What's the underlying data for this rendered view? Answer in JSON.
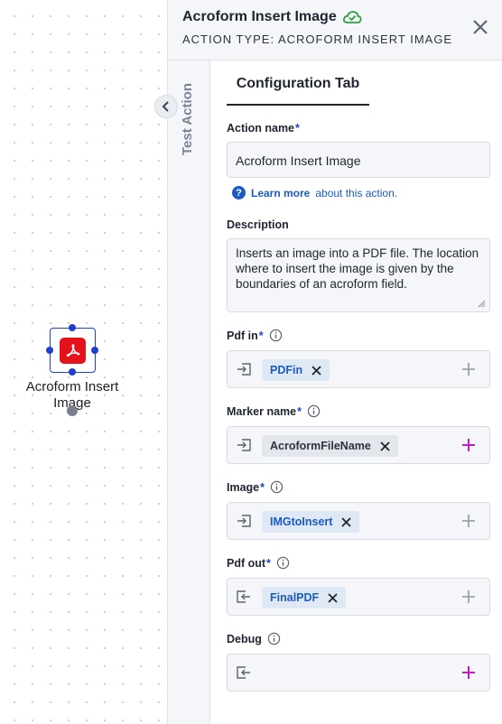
{
  "canvas": {
    "node_label": "Acroform Insert Image"
  },
  "panel": {
    "title": "Acroform Insert Image",
    "subtitle": "ACTION TYPE: ACROFORM INSERT IMAGE",
    "side_tab": "Test Action",
    "tab": "Configuration Tab"
  },
  "form": {
    "action_name_label": "Action name",
    "action_name_value": "Acroform Insert Image",
    "learn_more": "Learn more",
    "learn_more_rest": "about this action.",
    "description_label": "Description",
    "description_value": "Inserts an image into a PDF file. The location where to insert the image is given by the boundaries of an acroform field.",
    "fields": [
      {
        "label": "Pdf in",
        "chip": "PDFin",
        "direction": "input"
      },
      {
        "label": "Marker name",
        "chip": "AcroformFileName",
        "direction": "input"
      },
      {
        "label": "Image",
        "chip": "IMGtoInsert",
        "direction": "input"
      },
      {
        "label": "Pdf out",
        "chip": "FinalPDF",
        "direction": "output"
      },
      {
        "label": "Debug",
        "chip": "",
        "direction": "output"
      }
    ],
    "required_mark": "*"
  },
  "colors": {
    "accent": "#1f3fd1",
    "link": "#1a5bc4",
    "pdf_red": "#e5111b",
    "plus_magenta": "#c21fc2",
    "cloud_green": "#2e9e3e"
  },
  "icons": [
    "pdf-icon",
    "cloud-check-icon",
    "close-icon",
    "chevron-left-icon",
    "info-icon",
    "help-circle-icon",
    "input-arrow-icon",
    "output-arrow-icon",
    "remove-chip-icon",
    "plus-icon"
  ]
}
